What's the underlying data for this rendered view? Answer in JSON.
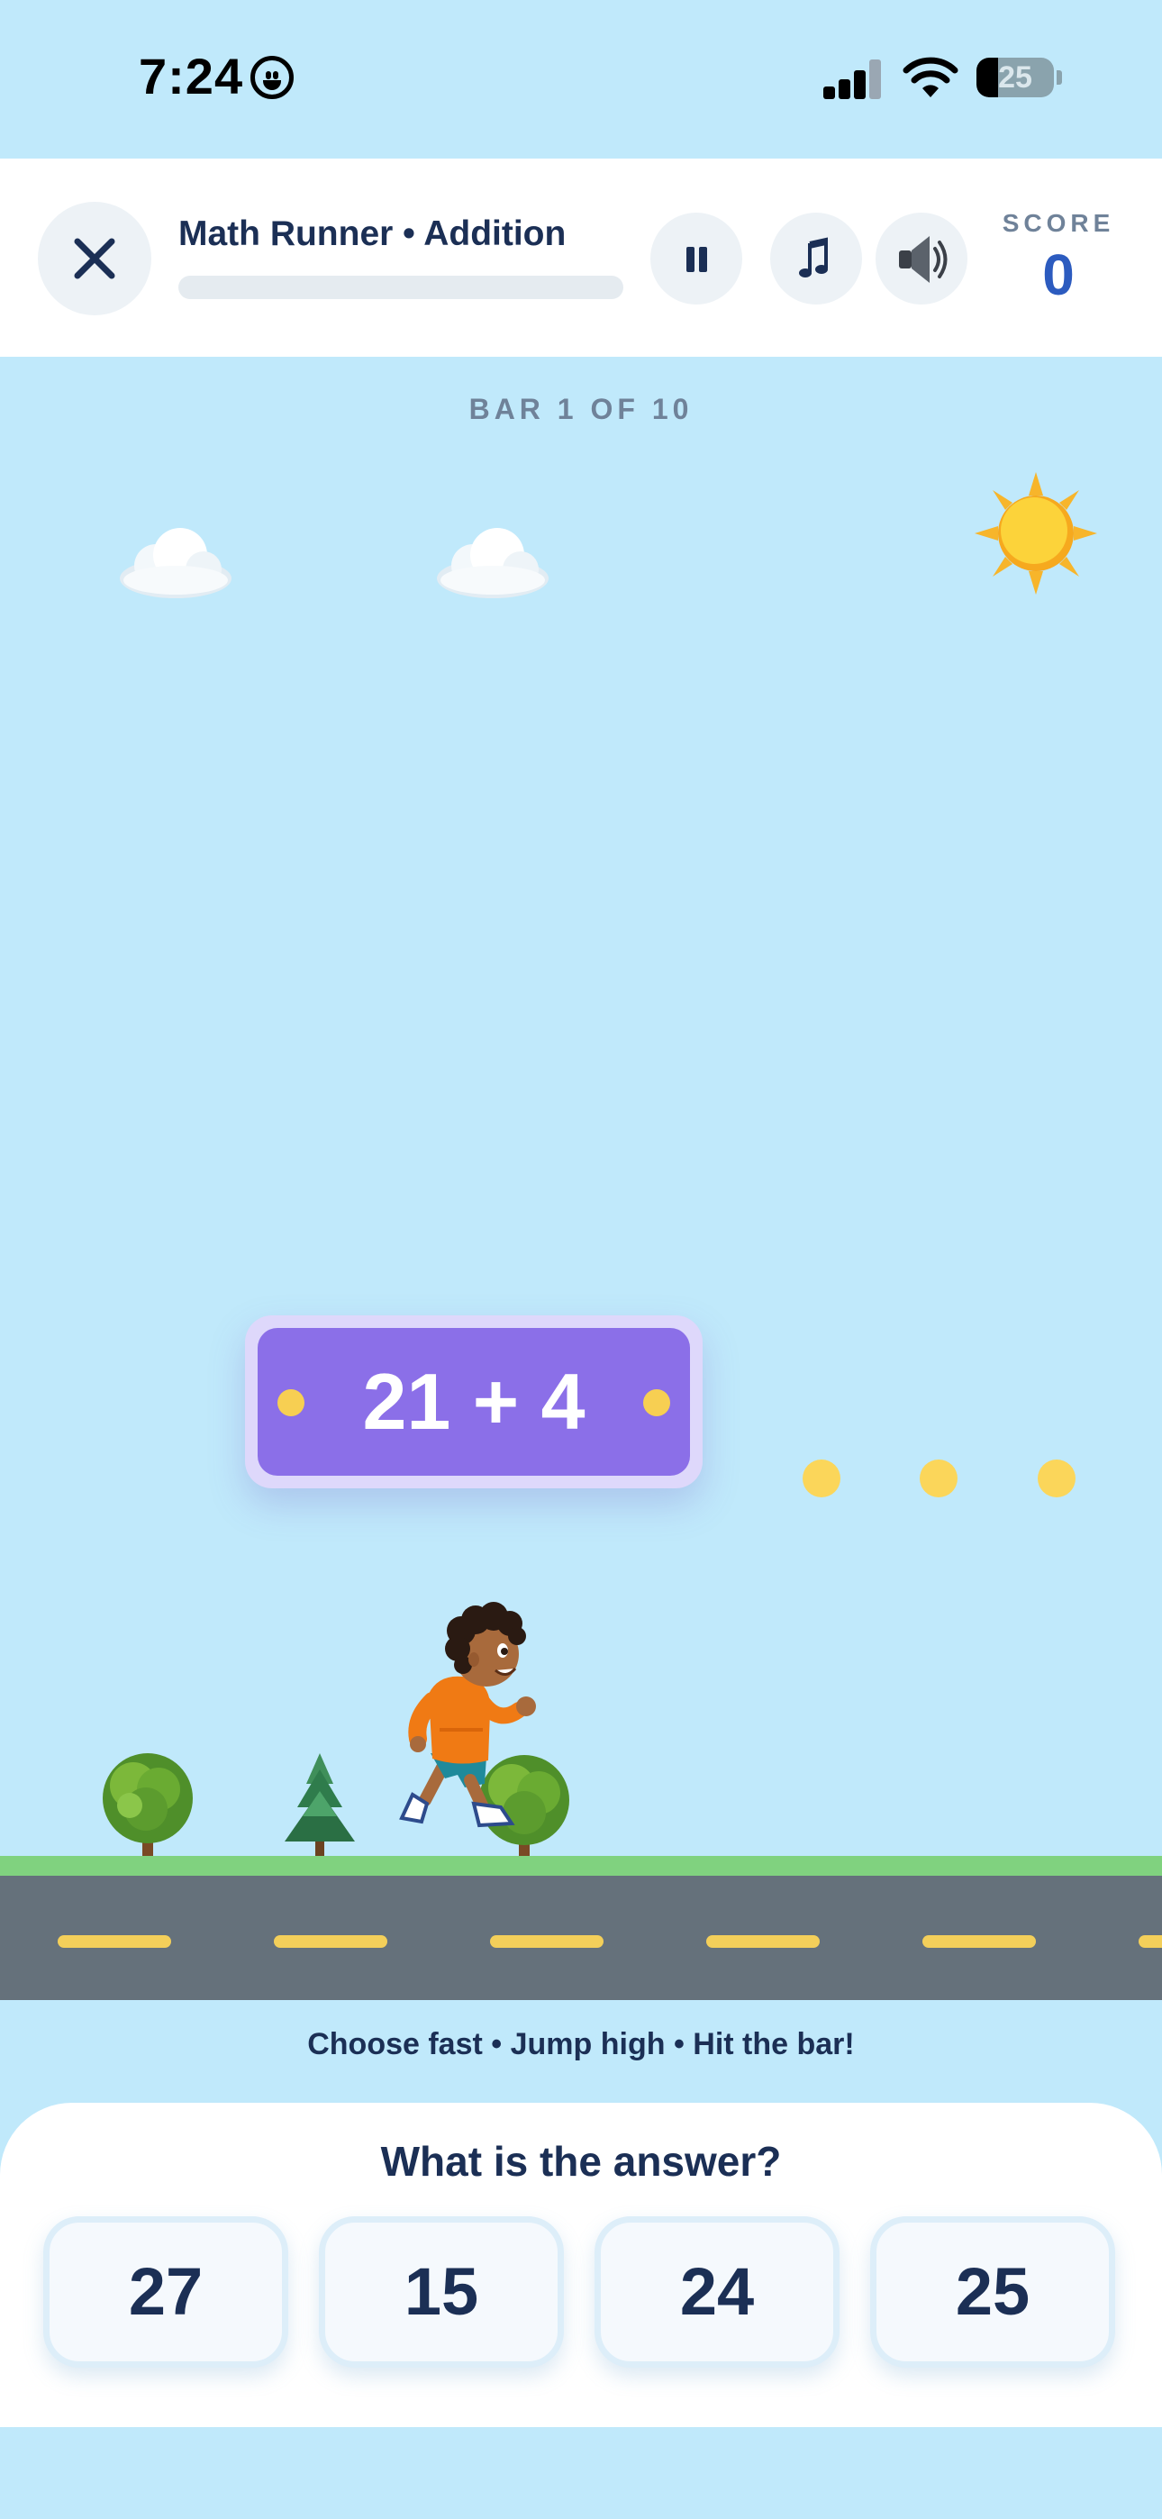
{
  "status_bar": {
    "time": "7:24",
    "battery_percent": "25",
    "signal_bars": 3,
    "icons": [
      "smiley-face-icon",
      "cellular-signal-icon",
      "wifi-icon",
      "battery-icon"
    ]
  },
  "header": {
    "title": "Math Runner • Addition",
    "progress_fraction": 0,
    "close_icon": "close-x-icon",
    "pause_icon": "pause-icon",
    "music_icon": "music-note-icon",
    "sound_icon": "speaker-icon",
    "score_label": "SCORE",
    "score_value": "0"
  },
  "scene": {
    "bar_counter": "BAR 1 OF 10",
    "question": "21 + 4",
    "coins_visible": 3,
    "decorations": [
      "cloud",
      "cloud",
      "sun",
      "tree",
      "pine-tree",
      "tree"
    ],
    "character": "runner-boy"
  },
  "tagline": "Choose fast • Jump high • Hit the bar!",
  "answers": {
    "prompt": "What is the answer?",
    "options": [
      "27",
      "15",
      "24",
      "25"
    ]
  },
  "colors": {
    "sky": "#c0e9fb",
    "bar_purple": "#8b6fe8",
    "coin_yellow": "#fbd65a",
    "road": "#65717b",
    "grass": "#80d27f",
    "score_blue": "#2c5bbf",
    "text_navy": "#1b2f55"
  }
}
